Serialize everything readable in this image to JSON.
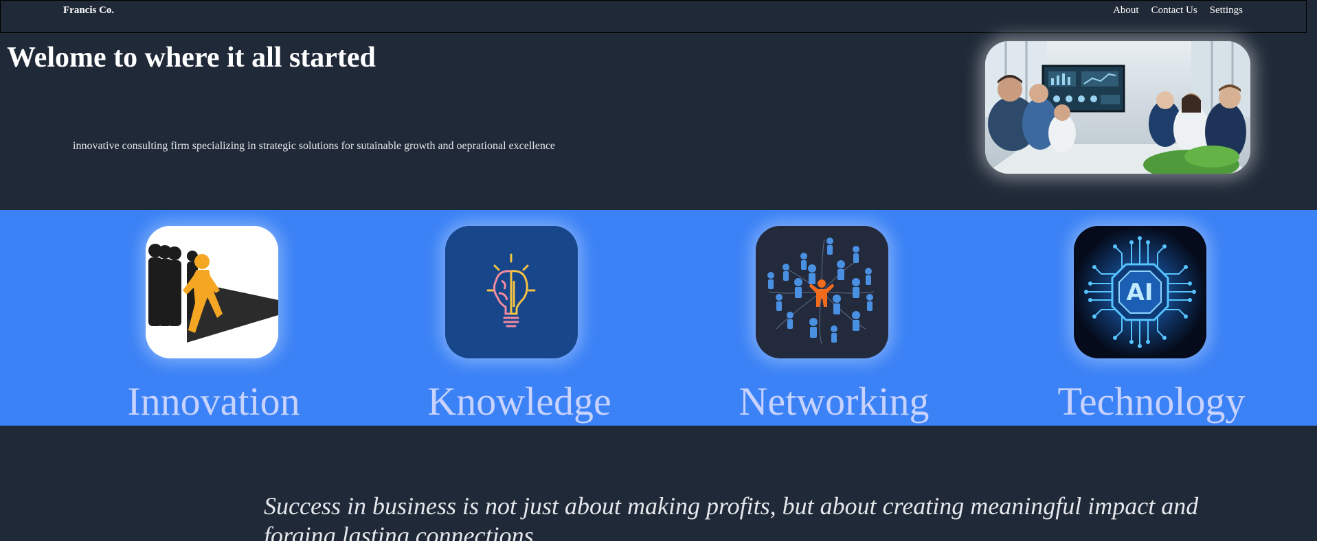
{
  "nav": {
    "brand": "Francis Co.",
    "links": [
      "About",
      "Contact Us",
      "Settings"
    ]
  },
  "hero": {
    "title": "Welome to where it all started",
    "tagline": "innovative consulting firm specializing in strategic solutions for sutainable growth and oeprational excellence",
    "image_icon": "business-meeting-photo"
  },
  "features": [
    {
      "label": "Innovation",
      "icon": "leader-walking-icon"
    },
    {
      "label": "Knowledge",
      "icon": "brain-lightbulb-icon"
    },
    {
      "label": "Networking",
      "icon": "people-network-icon"
    },
    {
      "label": "Technology",
      "icon": "ai-chip-icon"
    }
  ],
  "quote": "Success in business is not just about making profits, but about creating meaningful impact and forging lasting connections.",
  "colors": {
    "background": "#1f2937",
    "band": "#3b82f6",
    "label": "#c7d2fe",
    "accent_orange": "#f59e0b"
  }
}
